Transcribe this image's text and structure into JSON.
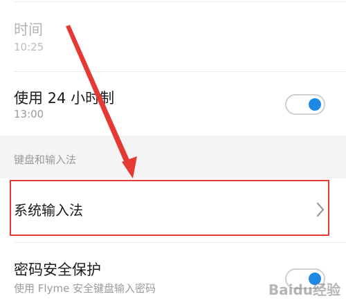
{
  "time_row": {
    "title": "时间",
    "value": "10:25"
  },
  "hour24_row": {
    "title": "使用 24 小时制",
    "value": "13:00",
    "toggle_on": true
  },
  "section": {
    "label": "键盘和输入法"
  },
  "input_row": {
    "title": "系统输入法"
  },
  "password_row": {
    "title": "密码安全保护",
    "subtitle": "使用 Flyme 安全键盘输入密码",
    "toggle_on": true
  },
  "watermark": {
    "text": "Baidu经验"
  },
  "colors": {
    "accent": "#1e88e5",
    "annotation": "#e53935"
  }
}
